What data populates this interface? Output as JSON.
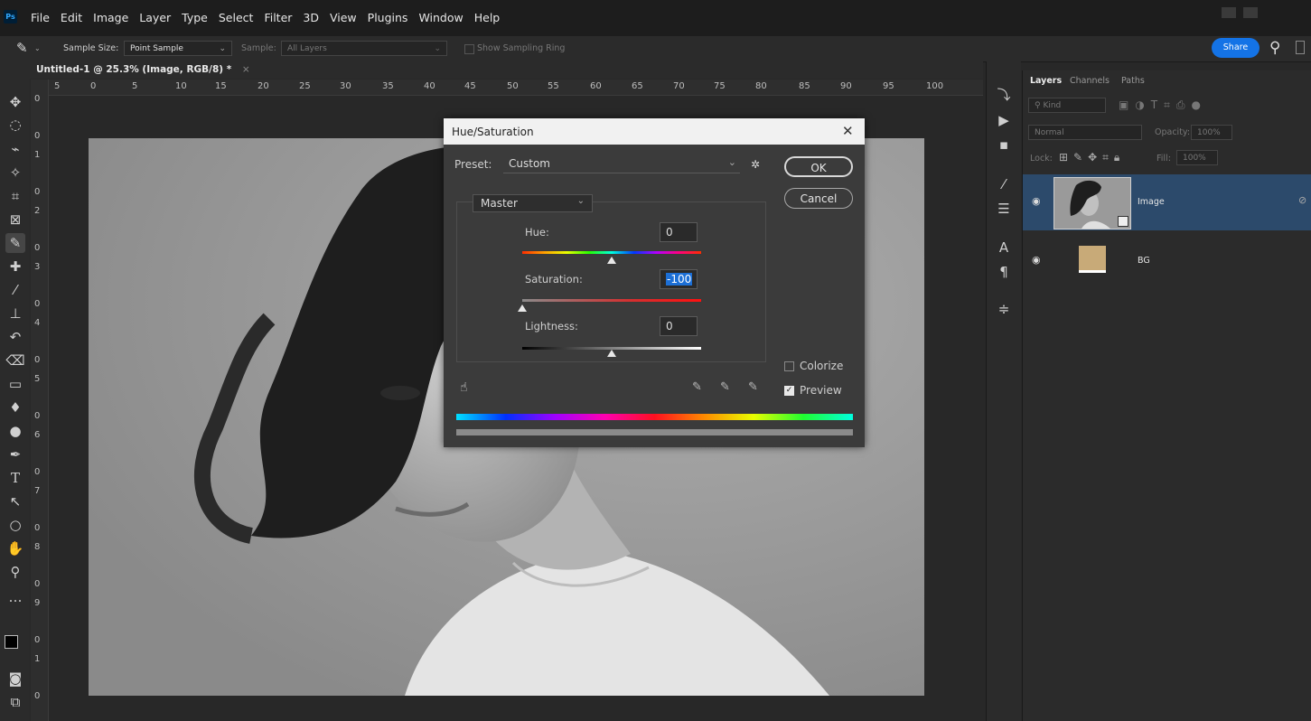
{
  "app": {
    "logo": "Ps"
  },
  "menu": [
    "File",
    "Edit",
    "Image",
    "Layer",
    "Type",
    "Select",
    "Filter",
    "3D",
    "View",
    "Plugins",
    "Window",
    "Help"
  ],
  "options": {
    "sample_size_label": "Sample Size:",
    "sample_size_value": "Point Sample",
    "sample_label": "Sample:",
    "sample_value": "All Layers",
    "show_ring_label": "Show Sampling Ring",
    "share_label": "Share"
  },
  "document": {
    "tab_title": "Untitled-1 @ 25.3% (Image, RGB/8) *"
  },
  "ruler": {
    "top": [
      "5",
      "0",
      "5",
      "10",
      "15",
      "20",
      "25",
      "30",
      "35",
      "40",
      "45",
      "50",
      "55",
      "60",
      "65",
      "70",
      "75",
      "80",
      "85",
      "90",
      "95",
      "100"
    ],
    "left": [
      "0",
      "0",
      "1",
      "0",
      "2",
      "0",
      "3",
      "0",
      "4",
      "0",
      "5",
      "0",
      "6",
      "0",
      "7",
      "0",
      "8",
      "0",
      "9",
      "0",
      "1",
      "0"
    ]
  },
  "layers_panel": {
    "tabs": [
      "Layers",
      "Channels",
      "Paths"
    ],
    "kind_label": "Kind",
    "blend_mode": "Normal",
    "opacity_label": "Opacity:",
    "opacity_value": "100%",
    "lock_label": "Lock:",
    "fill_label": "Fill:",
    "fill_value": "100%",
    "layers": [
      {
        "name": "Image",
        "selected": true
      },
      {
        "name": "BG",
        "selected": false,
        "swatch": "#c8aa78"
      }
    ]
  },
  "dialog": {
    "title": "Hue/Saturation",
    "preset_label": "Preset:",
    "preset_value": "Custom",
    "ok_label": "OK",
    "cancel_label": "Cancel",
    "channel_value": "Master",
    "hue_label": "Hue:",
    "hue_value": "0",
    "saturation_label": "Saturation:",
    "saturation_value": "-100",
    "lightness_label": "Lightness:",
    "lightness_value": "0",
    "colorize_label": "Colorize",
    "colorize_checked": false,
    "preview_label": "Preview",
    "preview_checked": true,
    "hue_slider_level": 0.5,
    "saturation_slider_level": 0.0,
    "lightness_slider_level": 0.5
  },
  "colors": {
    "accent": "#1473e6",
    "selected_layer": "#2c4a6b"
  }
}
